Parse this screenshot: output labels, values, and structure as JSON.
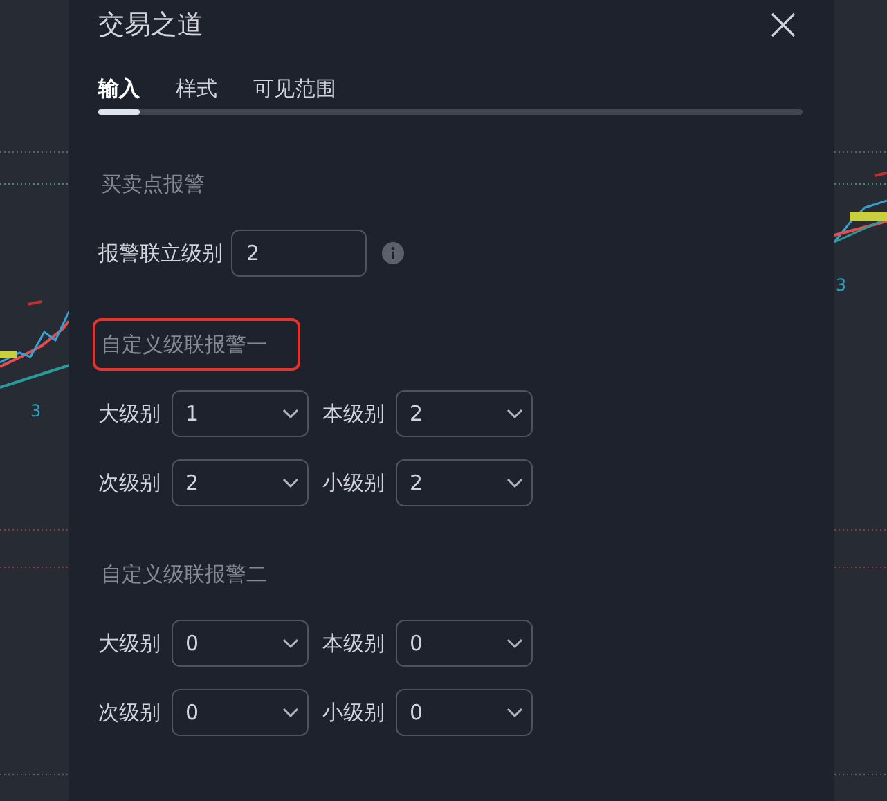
{
  "background_chart": {
    "labels": [
      {
        "text": "3"
      },
      {
        "text": "3"
      }
    ]
  },
  "dialog": {
    "title": "交易之道",
    "tabs": [
      {
        "label": "输入",
        "selected": true
      },
      {
        "label": "样式",
        "selected": false
      },
      {
        "label": "可见范围",
        "selected": false
      }
    ],
    "sections": [
      {
        "heading": "买卖点报警",
        "highlighted": false,
        "fields": [
          {
            "kind": "input",
            "label": "报警联立级别",
            "value": "2",
            "info": true
          }
        ]
      },
      {
        "heading": "自定义级联报警一",
        "highlighted": true,
        "fields": [
          {
            "kind": "select",
            "label": "大级别",
            "value": "1"
          },
          {
            "kind": "select",
            "label": "本级别",
            "value": "2"
          },
          {
            "kind": "select",
            "label": "次级别",
            "value": "2"
          },
          {
            "kind": "select",
            "label": "小级别",
            "value": "2"
          }
        ]
      },
      {
        "heading": "自定义级联报警二",
        "highlighted": false,
        "fields": [
          {
            "kind": "select",
            "label": "大级别",
            "value": "0"
          },
          {
            "kind": "select",
            "label": "本级别",
            "value": "0"
          },
          {
            "kind": "select",
            "label": "次级别",
            "value": "0"
          },
          {
            "kind": "select",
            "label": "小级别",
            "value": "0"
          }
        ]
      }
    ]
  }
}
